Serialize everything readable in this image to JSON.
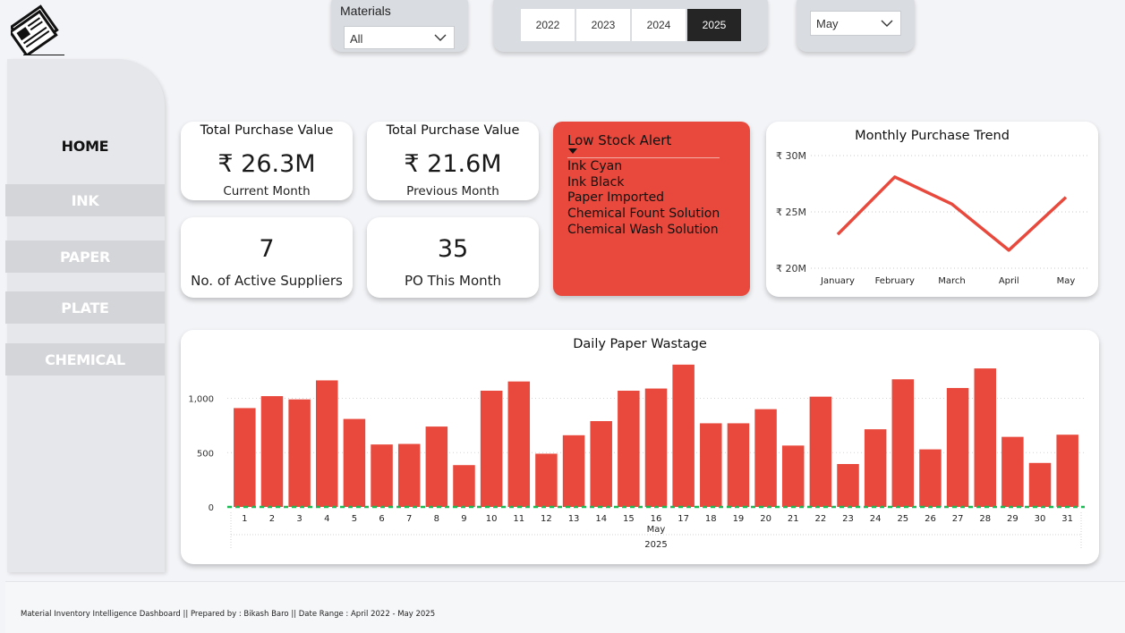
{
  "nav": {
    "items": [
      {
        "label": "HOME",
        "active": true
      },
      {
        "label": "INK",
        "active": false
      },
      {
        "label": "PAPER",
        "active": false
      },
      {
        "label": "PLATE",
        "active": false
      },
      {
        "label": "CHEMICAL",
        "active": false
      }
    ]
  },
  "filters": {
    "materials_label": "Materials",
    "materials_value": "All",
    "years": [
      "2022",
      "2023",
      "2024",
      "2025"
    ],
    "selected_year": "2025",
    "month_value": "May"
  },
  "kpis": {
    "current": {
      "title": "Total Purchase Value",
      "value": "₹ 26.3M",
      "sub": "Current Month"
    },
    "previous": {
      "title": "Total Purchase Value",
      "value": "₹ 21.6M",
      "sub": "Previous Month"
    },
    "suppliers": {
      "value": "7",
      "sub": "No. of  Active Suppliers"
    },
    "po": {
      "value": "35",
      "sub": "PO This Month"
    }
  },
  "alert": {
    "title": "Low Stock Alert",
    "items": [
      "Ink Cyan",
      "Ink Black",
      "Paper Imported",
      "Chemical Fount Solution",
      "Chemical Wash Solution"
    ]
  },
  "colors": {
    "accent": "#e8493c",
    "zero_line": "#1db954",
    "selected": "#252525"
  },
  "icons": {
    "logo": "newspaper-icon",
    "dropdown": "chevron-down-icon",
    "alert_marker": "caret-down-icon"
  },
  "chart_data": [
    {
      "type": "line",
      "title": "Monthly Purchase Trend",
      "x": [
        "January",
        "February",
        "March",
        "April",
        "May"
      ],
      "values": [
        23.0,
        28.1,
        25.7,
        21.6,
        26.3
      ],
      "unit": "₹M",
      "yticks": [
        "₹ 20M",
        "₹ 25M",
        "₹ 30M"
      ],
      "ylim": [
        20,
        30
      ],
      "grid": true
    },
    {
      "type": "bar",
      "title": "Daily Paper Wastage",
      "categories": [
        "1",
        "2",
        "3",
        "4",
        "5",
        "6",
        "7",
        "8",
        "9",
        "10",
        "11",
        "12",
        "13",
        "14",
        "15",
        "16",
        "17",
        "18",
        "19",
        "20",
        "21",
        "22",
        "23",
        "24",
        "25",
        "26",
        "27",
        "28",
        "29",
        "30",
        "31"
      ],
      "values": [
        910,
        1020,
        990,
        1165,
        810,
        575,
        580,
        740,
        385,
        1070,
        1155,
        490,
        660,
        790,
        1070,
        1090,
        1310,
        770,
        770,
        900,
        565,
        1015,
        395,
        715,
        1175,
        530,
        1095,
        1275,
        645,
        405,
        665
      ],
      "yticks": [
        "0",
        "500",
        "1,000"
      ],
      "ylim": [
        0,
        1330
      ],
      "x_group_labels": [
        "May",
        "2025"
      ],
      "grid": true
    }
  ],
  "footer": {
    "text": "Material Inventory Intelligence Dashboard || Prepared by : Bikash Baro || Date Range : April 2022 - May 2025"
  }
}
